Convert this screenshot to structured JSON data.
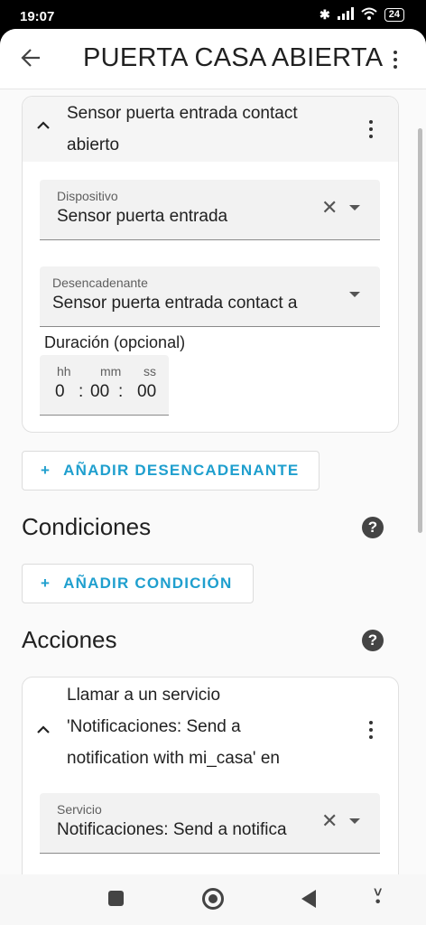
{
  "status": {
    "time": "19:07",
    "battery": "24"
  },
  "header": {
    "title": "PUERTA CASA ABIERTA"
  },
  "trigger_card": {
    "title_line1": "Sensor puerta entrada contact",
    "title_line2": "abierto",
    "device": {
      "label": "Dispositivo",
      "value": "Sensor puerta entrada"
    },
    "trigger": {
      "label": "Desencadenante",
      "value": "Sensor puerta entrada contact a"
    },
    "duration": {
      "label": "Duración (opcional)",
      "hh_label": "hh",
      "mm_label": "mm",
      "ss_label": "ss",
      "hh": "0",
      "mm": "00",
      "ss": "00",
      "sep": ":"
    }
  },
  "add_trigger_button": {
    "plus": "+",
    "label": "AÑADIR DESENCADENANTE"
  },
  "conditions": {
    "title": "Condiciones",
    "help": "?"
  },
  "add_condition_button": {
    "plus": "+",
    "label": "AÑADIR CONDICIÓN"
  },
  "actions": {
    "title": "Acciones",
    "help": "?"
  },
  "action_card": {
    "title_line1": "Llamar a un servicio",
    "title_line2": "'Notificaciones: Send a",
    "title_line3": "notification with mi_casa' en",
    "service": {
      "label": "Servicio",
      "value": "Notificaciones: Send a notifica"
    }
  },
  "icons": {
    "back": "back-arrow-icon",
    "more": "more-vert-icon",
    "chevron": "chevron-up-icon",
    "clear": "clear-icon",
    "dropdown": "dropdown-caret-icon",
    "help": "help-circle-icon"
  },
  "colors": {
    "accent": "#1f9fce",
    "background": "#fafafa",
    "card": "#ffffff"
  }
}
